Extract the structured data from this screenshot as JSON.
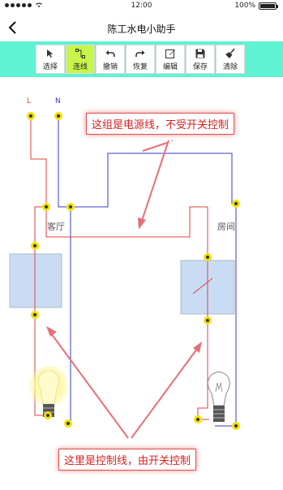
{
  "status": {
    "time": "12:00",
    "battery": "100%"
  },
  "nav": {
    "title": "陈工水电小助手"
  },
  "toolbar": {
    "tools": [
      {
        "label": "选择",
        "icon": "cursor-icon",
        "active": false
      },
      {
        "label": "连线",
        "icon": "connect-icon",
        "active": true
      },
      {
        "label": "撤销",
        "icon": "undo-icon",
        "active": false
      },
      {
        "label": "恢复",
        "icon": "redo-icon",
        "active": false
      },
      {
        "label": "编辑",
        "icon": "edit-icon",
        "active": false
      },
      {
        "label": "保存",
        "icon": "save-icon",
        "active": false
      },
      {
        "label": "清除",
        "icon": "broom-icon",
        "active": false
      }
    ]
  },
  "diagram": {
    "wire_labels": {
      "live": "L",
      "neutral": "N"
    },
    "rooms": {
      "left": "客厅",
      "right": "房间"
    },
    "callouts": {
      "power": "这组是电源线，不受开关控制",
      "control": "这里是控制线，由开关控制"
    },
    "colors": {
      "live": "#e04040",
      "neutral": "#3a3acc",
      "node": "#f4e000",
      "switch": "#c9dcf4",
      "callout": "#d82020"
    }
  }
}
